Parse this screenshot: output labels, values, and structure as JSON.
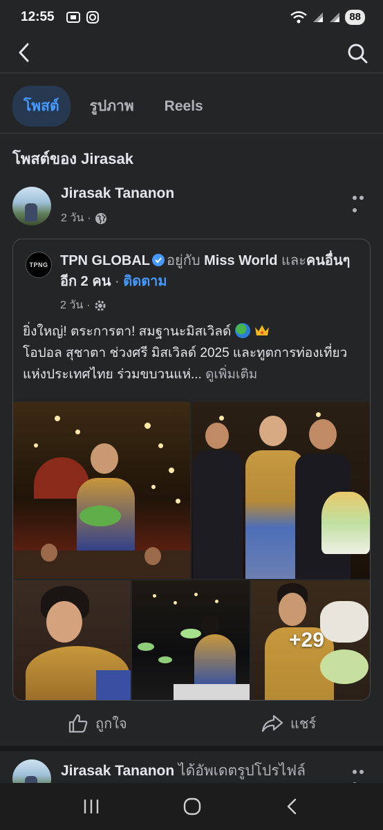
{
  "status_bar": {
    "time": "12:55",
    "battery": "88"
  },
  "tabs": [
    {
      "label": "โพสต์",
      "active": true
    },
    {
      "label": "รูปภาพ",
      "active": false
    },
    {
      "label": "Reels",
      "active": false
    }
  ],
  "section_title": "โพสต์ของ Jirasak",
  "post": {
    "author": "Jirasak Tananon",
    "time": "2 วัน",
    "shared": {
      "page_name": "TPN GLOBAL",
      "logo_text": "TPNG",
      "with_text": "อยู่กับ",
      "with_page": "Miss World",
      "and_text": "และ",
      "others_text": "คนอื่นๆ อีก 2 คน",
      "follow": "ติดตาม",
      "time": "2 วัน",
      "text_line1": "ยิ่งใหญ่! ตระการตา! สมฐานะมิสเวิลด์",
      "text_line2": "โอปอล สุชาตา ช่วงศรี มิสเวิลด์ 2025 และทูตการท่องเที่ยวแห่งประเทศไทย ร่วมขบวนแห่...",
      "see_more": "ดูเพิ่มเติม",
      "extra_photos": "+29"
    },
    "actions": {
      "like": "ถูกใจ",
      "share": "แชร์"
    }
  },
  "next_post": {
    "author": "Jirasak Tananon",
    "text": "ได้อัพเดตรูปโปรไฟล์"
  },
  "colors": {
    "accent": "#4599ff",
    "background": "#242526",
    "tab_active_bg": "#263951"
  },
  "icons": [
    "back-arrow-icon",
    "search-icon",
    "globe-icon",
    "gear-icon",
    "verified-badge-icon",
    "more-icon",
    "like-icon",
    "share-icon",
    "recents-icon",
    "home-icon",
    "back-nav-icon"
  ]
}
